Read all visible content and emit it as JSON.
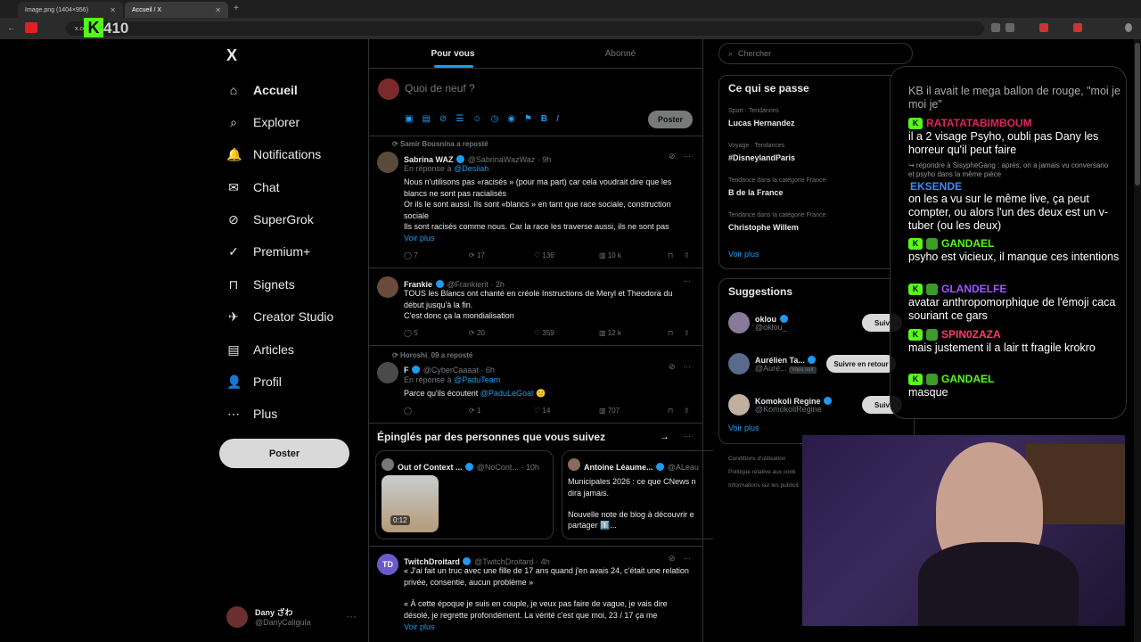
{
  "browser": {
    "tab1": "Image.png (1404×956)",
    "tab2": "Accueil / X",
    "url": "x.com",
    "counter": "410"
  },
  "nav": {
    "logo": "X",
    "items": [
      "Accueil",
      "Explorer",
      "Notifications",
      "Chat",
      "SuperGrok",
      "Premium+",
      "Signets",
      "Creator Studio",
      "Articles",
      "Profil",
      "Plus"
    ],
    "post": "Poster"
  },
  "account": {
    "name": "Dany ざわ",
    "handle": "@DanyCaligula"
  },
  "tabs": {
    "foryou": "Pour vous",
    "following": "Abonné"
  },
  "compose": {
    "placeholder": "Quoi de neuf ?",
    "post": "Poster"
  },
  "tweets": [
    {
      "repost": "Samir Bousnina a reposté",
      "name": "Sabrina WAZ",
      "handle": "@SabrinaWazWaz · 9h",
      "reply_label": "En réponse à",
      "reply_to": "@Desiiah",
      "text1": "Nous n'utilisons pas «racisés » (pour ma part) car cela voudrait dire que les blancs ne sont pas racialisés",
      "text2": "Or ils le sont aussi. Ils sont «blancs » en tant que race sociale, construction sociale",
      "text3": "Ils sont racisés comme nous. Car la race les traverse aussi, ils ne sont pas",
      "more": "Voir plus",
      "stats": [
        "7",
        "17",
        "136",
        "10 k"
      ]
    },
    {
      "name": "Frankie",
      "handle": "@Frankierit · 2h",
      "text1": "TOUS les Blancs ont chanté en créole Instructions de Meryl et Theodora du début jusqu'à la fin.",
      "text2": "C'est donc ça la mondialisation",
      "stats": [
        "5",
        "20",
        "359",
        "12 k"
      ]
    },
    {
      "repost": "Horoshi_09 a reposté",
      "name": "F",
      "handle": "@CyberCaaaat · 6h",
      "reply_label": "En réponse à",
      "reply_to": "@PaduTeam",
      "text1": "Parce qu'ils écoutent",
      "mention": "@PaduLeGoat",
      "stats": [
        "",
        "1",
        "14",
        "707"
      ]
    }
  ],
  "pinned": {
    "title": "Épinglés par des personnes que vous suivez",
    "c1_name": "Out of Context ...",
    "c1_handle": "@NoCont... · 10h",
    "c1_time": "0:12",
    "c2_name": "Antoine Léaume...",
    "c2_handle": "@ALeau",
    "c2_text1": "Municipales 2026 : ce que CNews n",
    "c2_text2": "dira jamais.",
    "c2_text3": "Nouvelle note de blog à découvrir e",
    "c2_text4": "partager 1️⃣..."
  },
  "tweet4": {
    "name": "TwitchDroitard",
    "handle": "@TwitchDroitard · 4h",
    "text1": "« J'ai fait un truc avec une fille de 17 ans quand j'en avais 24, c'était une relation privée, consentie, aucun problème »",
    "text2": "« À cette époque je suis en couple, je veux pas faire de vague, je vais dire désolé, je regrette profondément. La vérité c'est que moi, 23 / 17 ça me",
    "more": "Voir plus"
  },
  "search": {
    "placeholder": "Chercher"
  },
  "trends": {
    "title": "Ce qui se passe",
    "items": [
      {
        "cat": "Sport · Tendances",
        "name": "Lucas Hernandez"
      },
      {
        "cat": "Voyage · Tendances",
        "name": "#DisneylandParis"
      },
      {
        "cat": "Tendance dans la catégorie France",
        "name": "B de la France"
      },
      {
        "cat": "Tendance dans la catégorie France",
        "name": "Christophe Willem"
      }
    ],
    "more": "Voir plus"
  },
  "suggestions": {
    "title": "Suggestions",
    "items": [
      {
        "name": "oklou",
        "handle": "@oklou_",
        "btn": "Suiv"
      },
      {
        "name": "Aurélien Ta...",
        "handle": "@Aure...",
        "badge": "Vous suit",
        "btn": "Suivre en retour"
      },
      {
        "name": "Komokoli Regine",
        "handle": "@KomokoliRegine",
        "btn": "Suiv"
      }
    ],
    "more": "Voir plus"
  },
  "footer": {
    "l1": "Conditions d'utilisation",
    "l2": "Politique relative aux cook",
    "l3": "Informations sur les publicit"
  },
  "chat": {
    "m0": "KB il avait le mega ballon de rouge, \"moi je moi je\"",
    "u1": "RATATATABIMBOUM",
    "m1": "il a 2 visage Psyho, oubli pas Dany les horreur qu'il peut faire",
    "reply": "↪ répondre à SisypheGang : après, on a jamais vu conversano et psyho dans la même pièce",
    "u2": "EKSENDE",
    "m2": "on les a vu sur le même live, ça peut compter, ou alors l'un des deux est un v-tuber (ou les deux)",
    "u3": "GANDAEL",
    "m3": "psyho est vicieux, il manque ces intentions",
    "u4": "GLANDELFE",
    "m4": "avatar anthropomorphique de l'émoji caca souriant ce gars",
    "u5": "SPIN0ZAZA",
    "m5": "mais justement il a lair tt fragile krokro",
    "u6": "GANDAEL",
    "m6": "masque",
    "colors": {
      "u1": "#e0245e",
      "u2": "#3b8df0",
      "u3": "#53fc18",
      "u4": "#9b59ff",
      "u5": "#ff3b6b",
      "u6": "#53fc18"
    }
  }
}
